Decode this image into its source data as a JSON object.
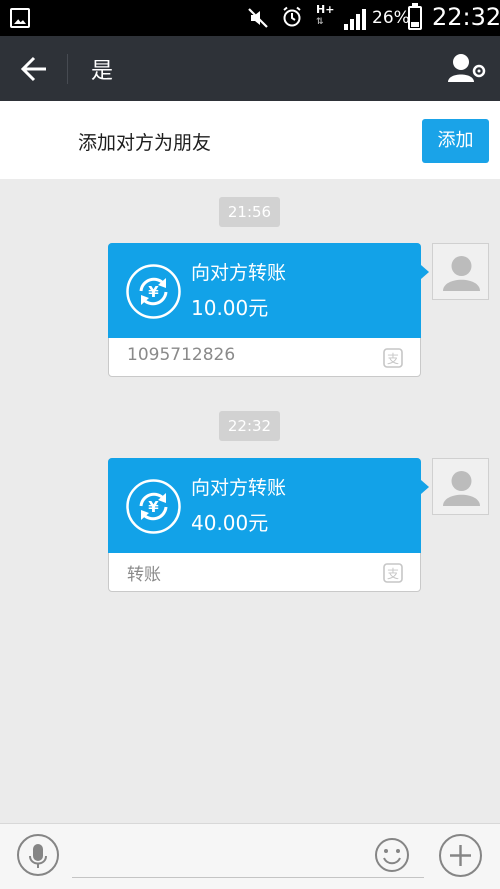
{
  "status_bar": {
    "network": "H+",
    "battery": "26%",
    "time": "22:32"
  },
  "title_bar": {
    "title": "是"
  },
  "add_bar": {
    "prompt": "添加对方为朋友",
    "button_label": "添加"
  },
  "messages": [
    {
      "timestamp": "21:56",
      "title": "向对方转账",
      "amount": "10.00元",
      "note": "1095712826"
    },
    {
      "timestamp": "22:32",
      "title": "向对方转账",
      "amount": "40.00元",
      "note": "转账"
    }
  ],
  "colors": {
    "accent": "#12a2e8",
    "title_bar": "#2e3238",
    "background": "#ebebeb"
  },
  "icons": {
    "back": "arrow-left-icon",
    "profile": "user-settings-icon",
    "voice": "microphone-icon",
    "emoji": "smiley-icon",
    "plus": "plus-icon",
    "transfer": "yuan-transfer-icon"
  }
}
